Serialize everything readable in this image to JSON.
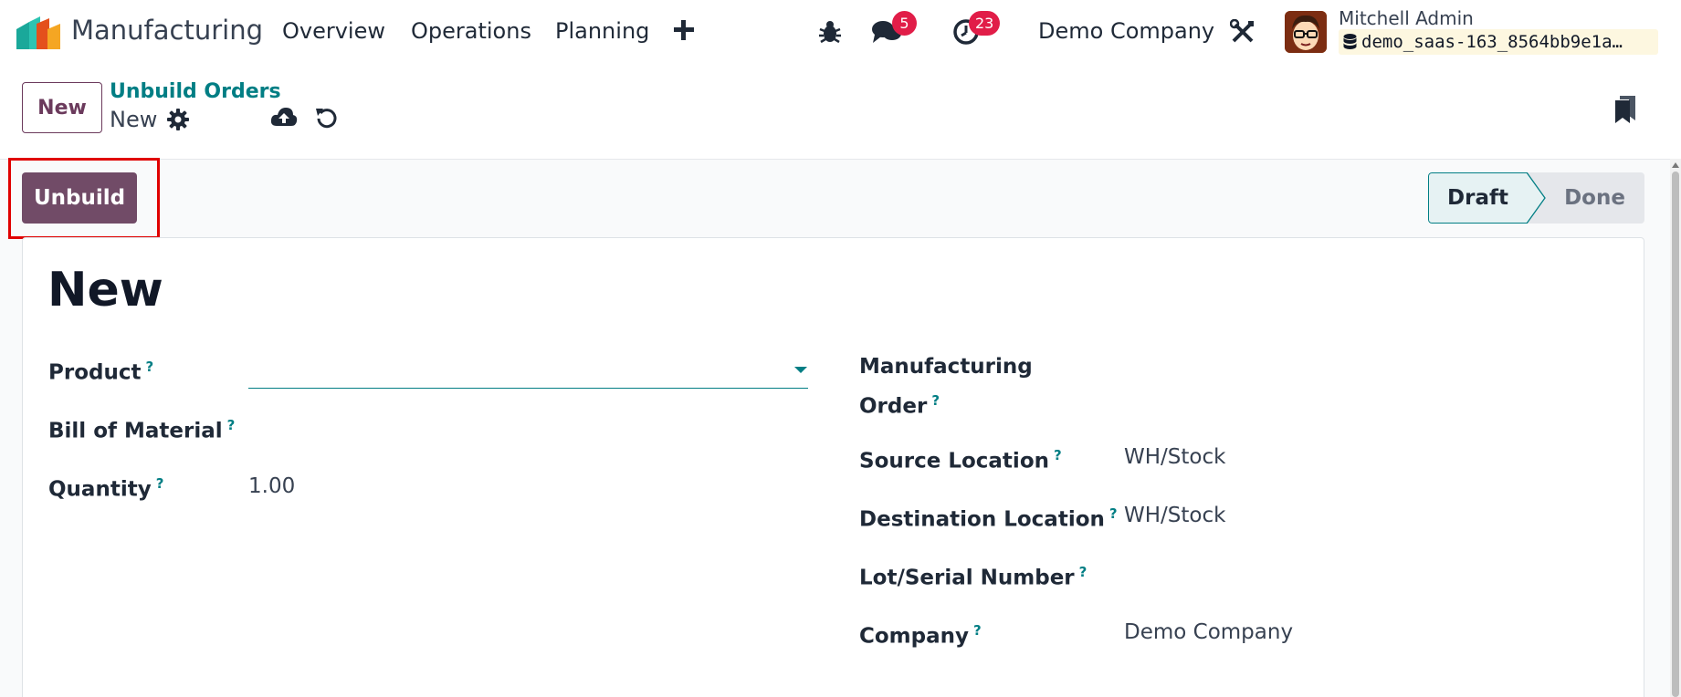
{
  "navbar": {
    "app_name": "Manufacturing",
    "menu": [
      "Overview",
      "Operations",
      "Planning"
    ],
    "messages_count": "5",
    "activities_count": "23",
    "company": "Demo Company",
    "user_name": "Mitchell Admin",
    "database": "demo_saas-163_8564bb9e1a…"
  },
  "control_panel": {
    "new_label": "New",
    "breadcrumb_parent": "Unbuild Orders",
    "breadcrumb_current": "New"
  },
  "actions": {
    "unbuild_label": "Unbuild"
  },
  "statusbar": {
    "stages": [
      "Draft",
      "Done"
    ],
    "current": "Draft"
  },
  "form": {
    "title": "New",
    "left": {
      "product_label": "Product",
      "product_value": "",
      "bom_label": "Bill of Material",
      "quantity_label": "Quantity",
      "quantity_value": "1.00"
    },
    "right": {
      "mo_label_line1": "Manufacturing",
      "mo_label_line2": "Order",
      "source_label": "Source Location",
      "source_value": "WH/Stock",
      "dest_label": "Destination Location",
      "dest_value": "WH/Stock",
      "lot_label": "Lot/Serial Number",
      "company_label": "Company",
      "company_value": "Demo Company"
    },
    "help_mark": "?"
  },
  "colors": {
    "primary": "#714b67",
    "accent": "#017e84",
    "badge": "#e11d48",
    "highlight": "#e00000"
  }
}
